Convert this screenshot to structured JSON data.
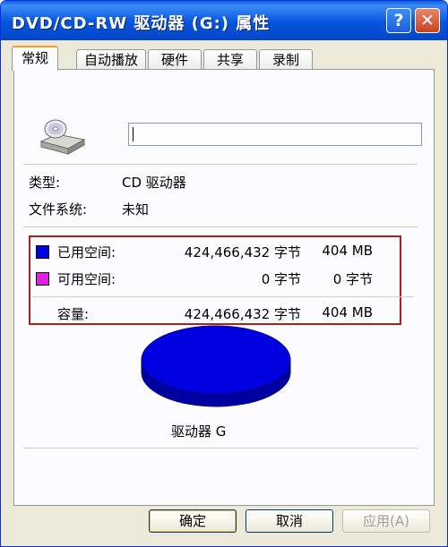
{
  "window": {
    "title": "DVD/CD-RW 驱动器 (G:) 属性",
    "help_label": "?",
    "close_label": "✕"
  },
  "tabs": [
    {
      "label": "常规",
      "active": true
    },
    {
      "label": "自动播放",
      "active": false
    },
    {
      "label": "硬件",
      "active": false
    },
    {
      "label": "共享",
      "active": false
    },
    {
      "label": "录制",
      "active": false
    }
  ],
  "general": {
    "drive_name_value": "",
    "type_label": "类型:",
    "type_value": "CD 驱动器",
    "fs_label": "文件系统:",
    "fs_value": "未知"
  },
  "space": {
    "used": {
      "label": "已用空间:",
      "bytes": "424,466,432 字节",
      "size": "404 MB",
      "color": "#0000e0"
    },
    "free": {
      "label": "可用空间:",
      "bytes": "0 字节",
      "size": "0 字节",
      "color": "#e020e0"
    },
    "capacity": {
      "label": "容量:",
      "bytes": "424,466,432 字节",
      "size": "404 MB"
    }
  },
  "pie": {
    "used_fraction": 1.0,
    "color": "#0000e0",
    "caption": "驱动器 G"
  },
  "buttons": {
    "ok": "确定",
    "cancel": "取消",
    "apply": "应用(A)"
  },
  "icons": {
    "drive": "cd-drive-icon",
    "help": "help-icon",
    "close": "close-icon"
  }
}
